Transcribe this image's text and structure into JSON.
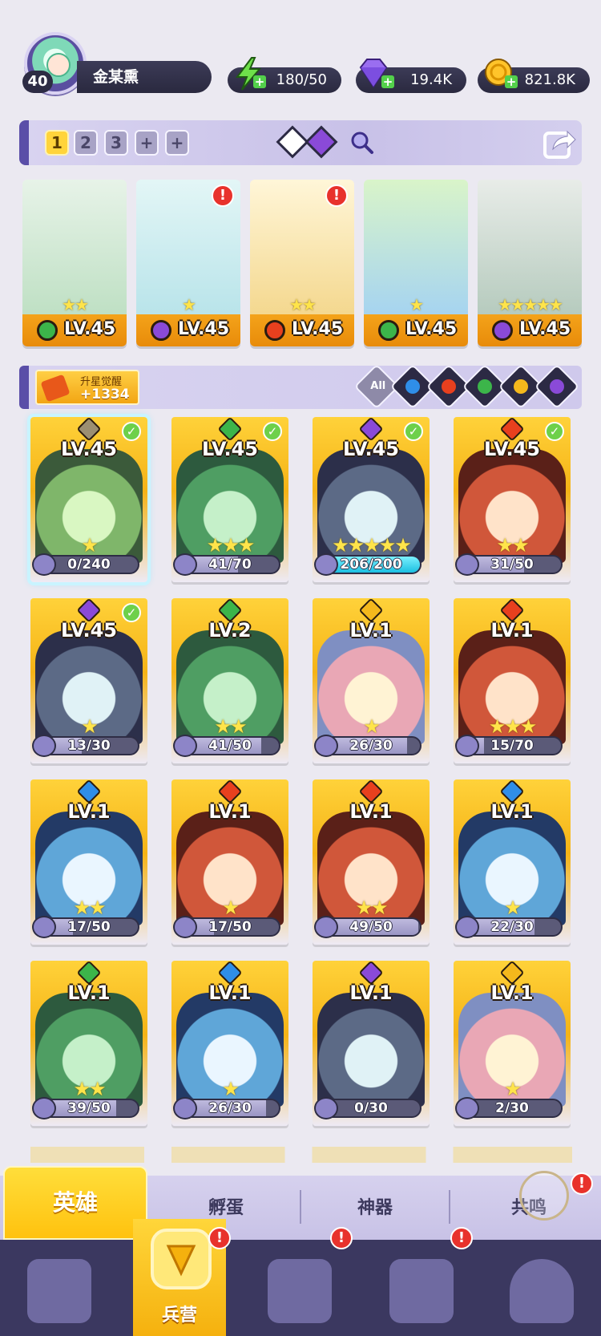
{
  "player": {
    "level": "40",
    "name": "金某熏"
  },
  "resources": {
    "energy": "180/50",
    "gems": "19.4K",
    "gold": "821.8K"
  },
  "team_slots": [
    "1",
    "2",
    "3",
    "+",
    "+"
  ],
  "team_heroes": [
    {
      "level": "LV.45",
      "stars": "★★",
      "element": "nature",
      "alert": false
    },
    {
      "level": "LV.45",
      "stars": "★",
      "element": "dark",
      "alert": true
    },
    {
      "level": "LV.45",
      "stars": "★★",
      "element": "fire",
      "alert": true
    },
    {
      "level": "LV.45",
      "stars": "★",
      "element": "nature",
      "alert": false
    },
    {
      "level": "LV.45",
      "stars": "★★★★★",
      "element": "dark",
      "alert": false
    }
  ],
  "awaken": {
    "title": "升星觉醒",
    "value": "+1334"
  },
  "filters": [
    {
      "name": "all",
      "label": "All"
    },
    {
      "name": "water"
    },
    {
      "name": "fire"
    },
    {
      "name": "nature"
    },
    {
      "name": "light"
    },
    {
      "name": "dark"
    }
  ],
  "heroes": [
    {
      "level": "LV.45",
      "shards": "0/240",
      "progress": 0,
      "stars": "★",
      "element": "shield",
      "check": true,
      "selected": true
    },
    {
      "level": "LV.45",
      "shards": "41/70",
      "progress": 0.58,
      "stars": "★★★",
      "element": "nature",
      "check": true
    },
    {
      "level": "LV.45",
      "shards": "206/200",
      "progress": 1,
      "stars": "★★★★★",
      "element": "dark",
      "check": true
    },
    {
      "level": "LV.45",
      "shards": "31/50",
      "progress": 0.62,
      "stars": "★★",
      "element": "fire",
      "check": true
    },
    {
      "level": "LV.45",
      "shards": "13/30",
      "progress": 0.43,
      "stars": "★",
      "element": "dark",
      "check": true
    },
    {
      "level": "LV.2",
      "shards": "41/50",
      "progress": 0.82,
      "stars": "★★",
      "element": "nature",
      "check": false
    },
    {
      "level": "LV.1",
      "shards": "26/30",
      "progress": 0.87,
      "stars": "★",
      "element": "light",
      "check": false
    },
    {
      "level": "LV.1",
      "shards": "15/70",
      "progress": 0.21,
      "stars": "★★★",
      "element": "fire",
      "check": false
    },
    {
      "level": "LV.1",
      "shards": "17/50",
      "progress": 0.34,
      "stars": "★★",
      "element": "water",
      "check": false
    },
    {
      "level": "LV.1",
      "shards": "17/50",
      "progress": 0.34,
      "stars": "★",
      "element": "fire",
      "check": false
    },
    {
      "level": "LV.1",
      "shards": "49/50",
      "progress": 0.98,
      "stars": "★★",
      "element": "fire",
      "check": false
    },
    {
      "level": "LV.1",
      "shards": "22/30",
      "progress": 0.73,
      "stars": "★",
      "element": "water",
      "check": false
    },
    {
      "level": "LV.1",
      "shards": "39/50",
      "progress": 0.78,
      "stars": "★★",
      "element": "nature",
      "check": false
    },
    {
      "level": "LV.1",
      "shards": "26/30",
      "progress": 0.87,
      "stars": "★",
      "element": "water",
      "check": false
    },
    {
      "level": "LV.1",
      "shards": "0/30",
      "progress": 0,
      "stars": "",
      "element": "dark",
      "check": false
    },
    {
      "level": "LV.1",
      "shards": "2/30",
      "progress": 0.07,
      "stars": "★",
      "element": "light",
      "check": false
    }
  ],
  "tabs": [
    "英雄",
    "孵蛋",
    "神器",
    "共鸣"
  ],
  "nav": {
    "active_label": "兵营"
  },
  "colors": {
    "water": "#2f8ee8",
    "fire": "#e8401e",
    "nature": "#3cb54a",
    "light": "#f4b81c",
    "dark": "#8a4ad8",
    "shield": "#9c8f72"
  }
}
